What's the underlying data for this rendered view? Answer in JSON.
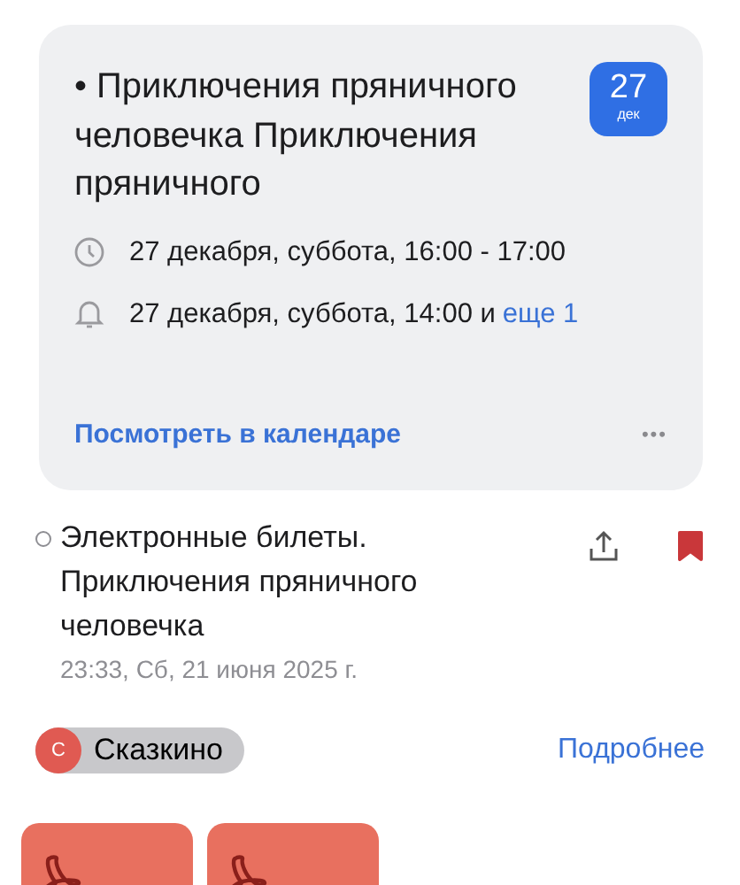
{
  "event_card": {
    "title": "• Приключения пряничного человечка Приключения пряничного",
    "date_badge": {
      "day": "27",
      "month": "дек"
    },
    "details": [
      {
        "kind": "time",
        "text": "27 декабря, суббота, 16:00 - 17:00"
      },
      {
        "kind": "reminder",
        "text": "27 декабря, суббота, 14:00 и",
        "link": "еще 1"
      }
    ],
    "calendar_link": "Посмотреть в календаре",
    "more": "•••"
  },
  "message": {
    "subject": "Электронные билеты. Приключения пряничного человечка",
    "date": "23:33, Сб, 21 июня 2025 г.",
    "unread": false,
    "flagged": true,
    "sender": {
      "initial": "С",
      "name": "Сказкино"
    },
    "details_link": "Подробнее",
    "attachments": [
      {
        "kind": "pdf"
      },
      {
        "kind": "pdf"
      }
    ]
  }
}
